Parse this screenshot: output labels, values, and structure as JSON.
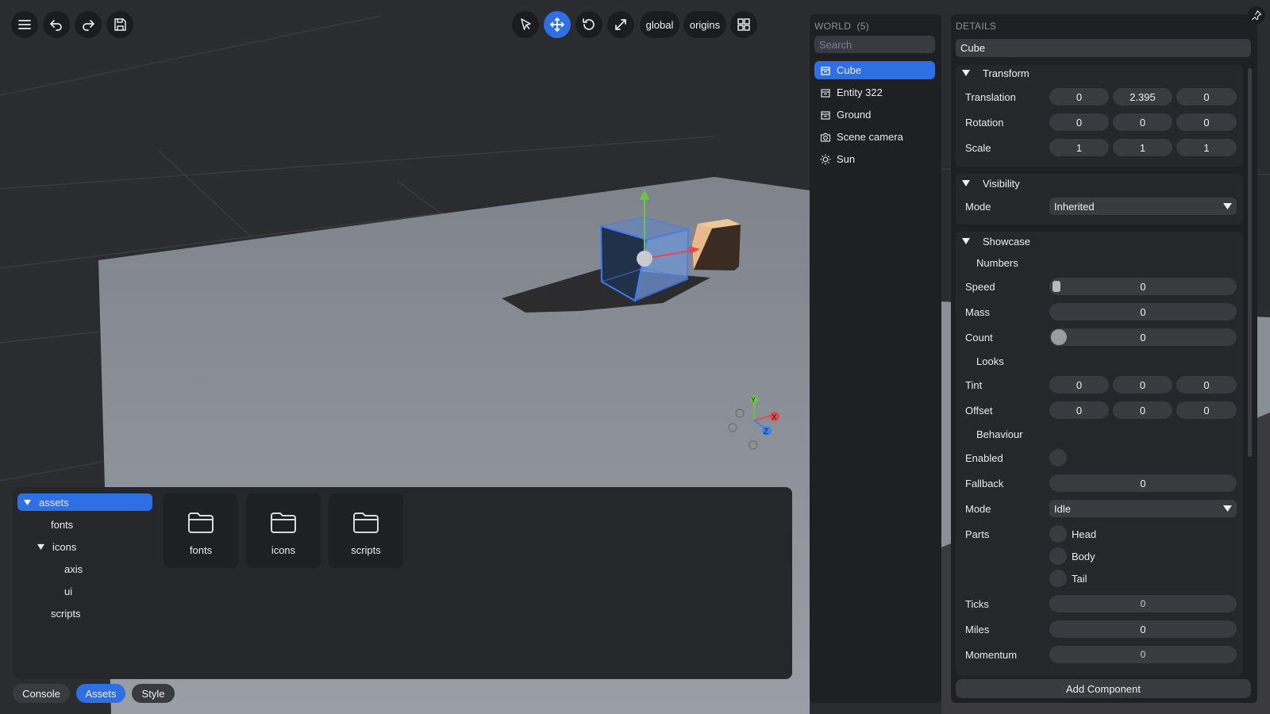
{
  "toolbar": {
    "mode_global": "global",
    "mode_origins": "origins"
  },
  "world": {
    "title": "WORLD",
    "count": "(5)",
    "search_placeholder": "Search",
    "entities": [
      {
        "label": "Cube",
        "icon": "cube-icon",
        "selected": true
      },
      {
        "label": "Entity 322",
        "icon": "cube-icon",
        "selected": false
      },
      {
        "label": "Ground",
        "icon": "cube-icon",
        "selected": false
      },
      {
        "label": "Scene camera",
        "icon": "camera-icon",
        "selected": false
      },
      {
        "label": "Sun",
        "icon": "sun-icon",
        "selected": false
      }
    ]
  },
  "details": {
    "title": "DETAILS",
    "name": "Cube",
    "transform": {
      "title": "Transform",
      "translation_label": "Translation",
      "translation": [
        "0",
        "2.395",
        "0"
      ],
      "rotation_label": "Rotation",
      "rotation": [
        "0",
        "0",
        "0"
      ],
      "scale_label": "Scale",
      "scale": [
        "1",
        "1",
        "1"
      ]
    },
    "visibility": {
      "title": "Visibility",
      "mode_label": "Mode",
      "mode_value": "Inherited"
    },
    "showcase": {
      "title": "Showcase",
      "numbers_label": "Numbers",
      "speed_label": "Speed",
      "speed": "0",
      "mass_label": "Mass",
      "mass": "0",
      "count_label": "Count",
      "count": "0",
      "looks_label": "Looks",
      "tint_label": "Tint",
      "tint": [
        "0",
        "0",
        "0"
      ],
      "offset_label": "Offset",
      "offset": [
        "0",
        "0",
        "0"
      ],
      "behaviour_label": "Behaviour",
      "enabled_label": "Enabled",
      "fallback_label": "Fallback",
      "fallback": "0",
      "mode_label": "Mode",
      "mode_value": "Idle",
      "parts_label": "Parts",
      "parts": [
        "Head",
        "Body",
        "Tail"
      ],
      "ticks_label": "Ticks",
      "ticks": "0",
      "miles_label": "Miles",
      "miles": "0",
      "momentum_label": "Momentum",
      "momentum": "0"
    },
    "add_component": "Add Component"
  },
  "assets": {
    "tree": [
      {
        "label": "assets",
        "depth": 0,
        "expanded": true,
        "selected": true
      },
      {
        "label": "fonts",
        "depth": 1,
        "expanded": false,
        "selected": false
      },
      {
        "label": "icons",
        "depth": 1,
        "expanded": true,
        "selected": false
      },
      {
        "label": "axis",
        "depth": 2,
        "expanded": false,
        "selected": false
      },
      {
        "label": "ui",
        "depth": 2,
        "expanded": false,
        "selected": false
      },
      {
        "label": "scripts",
        "depth": 1,
        "expanded": false,
        "selected": false
      }
    ],
    "folders": [
      "fonts",
      "icons",
      "scripts"
    ]
  },
  "bottom_tabs": {
    "console": "Console",
    "assets": "Assets",
    "style": "Style"
  },
  "gizmo": {
    "x": "X",
    "y": "Y",
    "z": "Z"
  },
  "colors": {
    "accent": "#2f6fe4",
    "panel": "#1f2023",
    "field": "#3a3b40",
    "ground": "#8f939b",
    "axis_x": "#e5484d",
    "axis_y": "#6cc24a",
    "axis_z": "#3b82f6"
  }
}
